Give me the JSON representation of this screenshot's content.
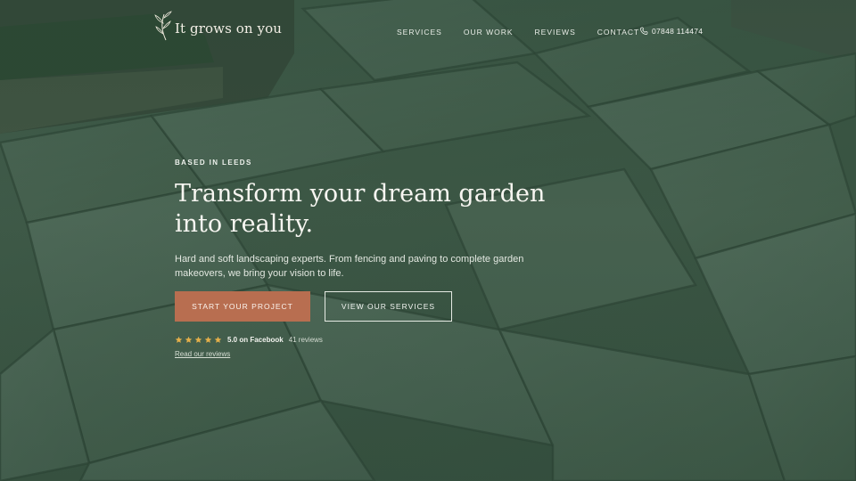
{
  "brand": {
    "name": "It grows on you"
  },
  "nav": {
    "items": [
      {
        "label": "SERVICES"
      },
      {
        "label": "OUR WORK"
      },
      {
        "label": "REVIEWS"
      },
      {
        "label": "CONTACT"
      }
    ],
    "phone": "07848 114474"
  },
  "hero": {
    "eyebrow": "BASED IN LEEDS",
    "headline": "Transform your dream garden into reality.",
    "subtext": "Hard and soft landscaping experts. From fencing and paving to complete garden makeovers, we bring your vision to life.",
    "primary_button": "START YOUR PROJECT",
    "secondary_button": "VIEW OUR SERVICES"
  },
  "rating": {
    "stars": 5,
    "score": "5.0 on Facebook",
    "count": "41 reviews",
    "link": "Read our reviews"
  },
  "colors": {
    "accent": "#b86e50",
    "overlay": "#3f5a48",
    "star": "#e5b04a"
  },
  "icons": {
    "logo": "leaf-sprig-icon",
    "phone": "phone-icon",
    "star": "star-icon"
  }
}
